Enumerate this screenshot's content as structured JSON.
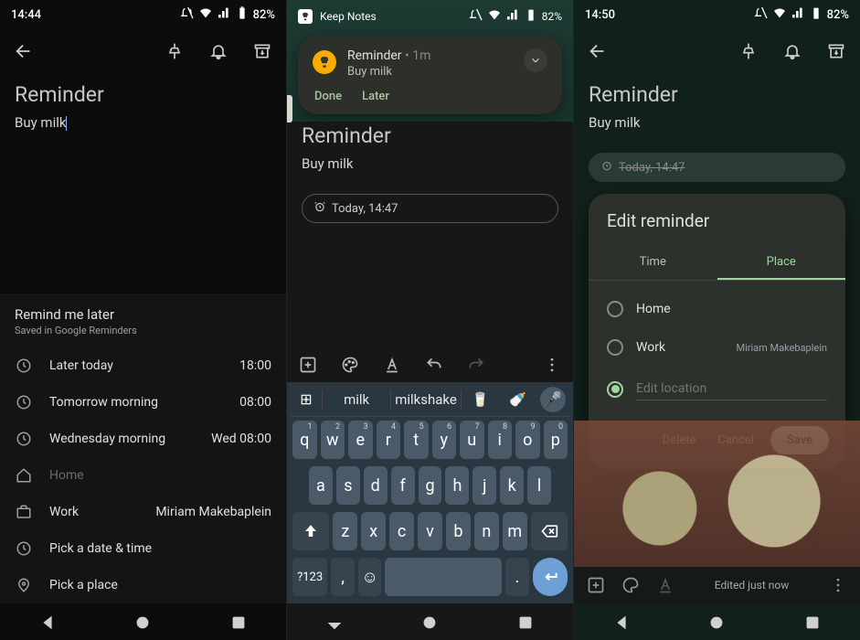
{
  "status": {
    "battery": "82%"
  },
  "s1": {
    "time": "14:44",
    "title": "Reminder",
    "body": "Buy milk",
    "panel_title": "Remind me later",
    "panel_sub": "Saved in Google Reminders",
    "rows": [
      {
        "icon": "clock",
        "label": "Later today",
        "value": "18:00"
      },
      {
        "icon": "clock",
        "label": "Tomorrow morning",
        "value": "08:00"
      },
      {
        "icon": "clock",
        "label": "Wednesday morning",
        "value": "Wed 08:00"
      },
      {
        "icon": "home",
        "label": "Home",
        "value": "",
        "dim": true
      },
      {
        "icon": "briefcase",
        "label": "Work",
        "value": "Miriam Makebaplein"
      },
      {
        "icon": "clock",
        "label": "Pick a date & time",
        "value": ""
      },
      {
        "icon": "pin",
        "label": "Pick a place",
        "value": ""
      }
    ]
  },
  "s2": {
    "app_label": "Keep Notes",
    "notif": {
      "title": "Reminder",
      "age": "1m",
      "body": "Buy milk",
      "action_done": "Done",
      "action_later": "Later"
    },
    "title": "Reminder",
    "body": "Buy milk",
    "chip": "Today, 14:47",
    "suggestions": [
      "milk",
      "milkshake"
    ],
    "emoji_sugg": [
      "🥛",
      "🍼"
    ],
    "keys": {
      "r1": [
        "q",
        "w",
        "e",
        "r",
        "t",
        "y",
        "u",
        "i",
        "o",
        "p"
      ],
      "n1": [
        "1",
        "2",
        "3",
        "4",
        "5",
        "6",
        "7",
        "8",
        "9",
        "0"
      ],
      "r2": [
        "a",
        "s",
        "d",
        "f",
        "g",
        "h",
        "j",
        "k",
        "l"
      ],
      "r3": [
        "z",
        "x",
        "c",
        "v",
        "b",
        "n",
        "m"
      ],
      "sym": "?123",
      "comma": ",",
      "period": "."
    }
  },
  "s3": {
    "time": "14:50",
    "title": "Reminder",
    "body": "Buy milk",
    "chip": "Today, 14:47",
    "dialog": {
      "title": "Edit reminder",
      "tab_time": "Time",
      "tab_place": "Place",
      "opt_home": "Home",
      "opt_work": "Work",
      "work_addr": "Miriam Makebaplein",
      "edit_placeholder": "Edit location",
      "delete": "Delete",
      "cancel": "Cancel",
      "save": "Save"
    },
    "edited": "Edited just now"
  }
}
